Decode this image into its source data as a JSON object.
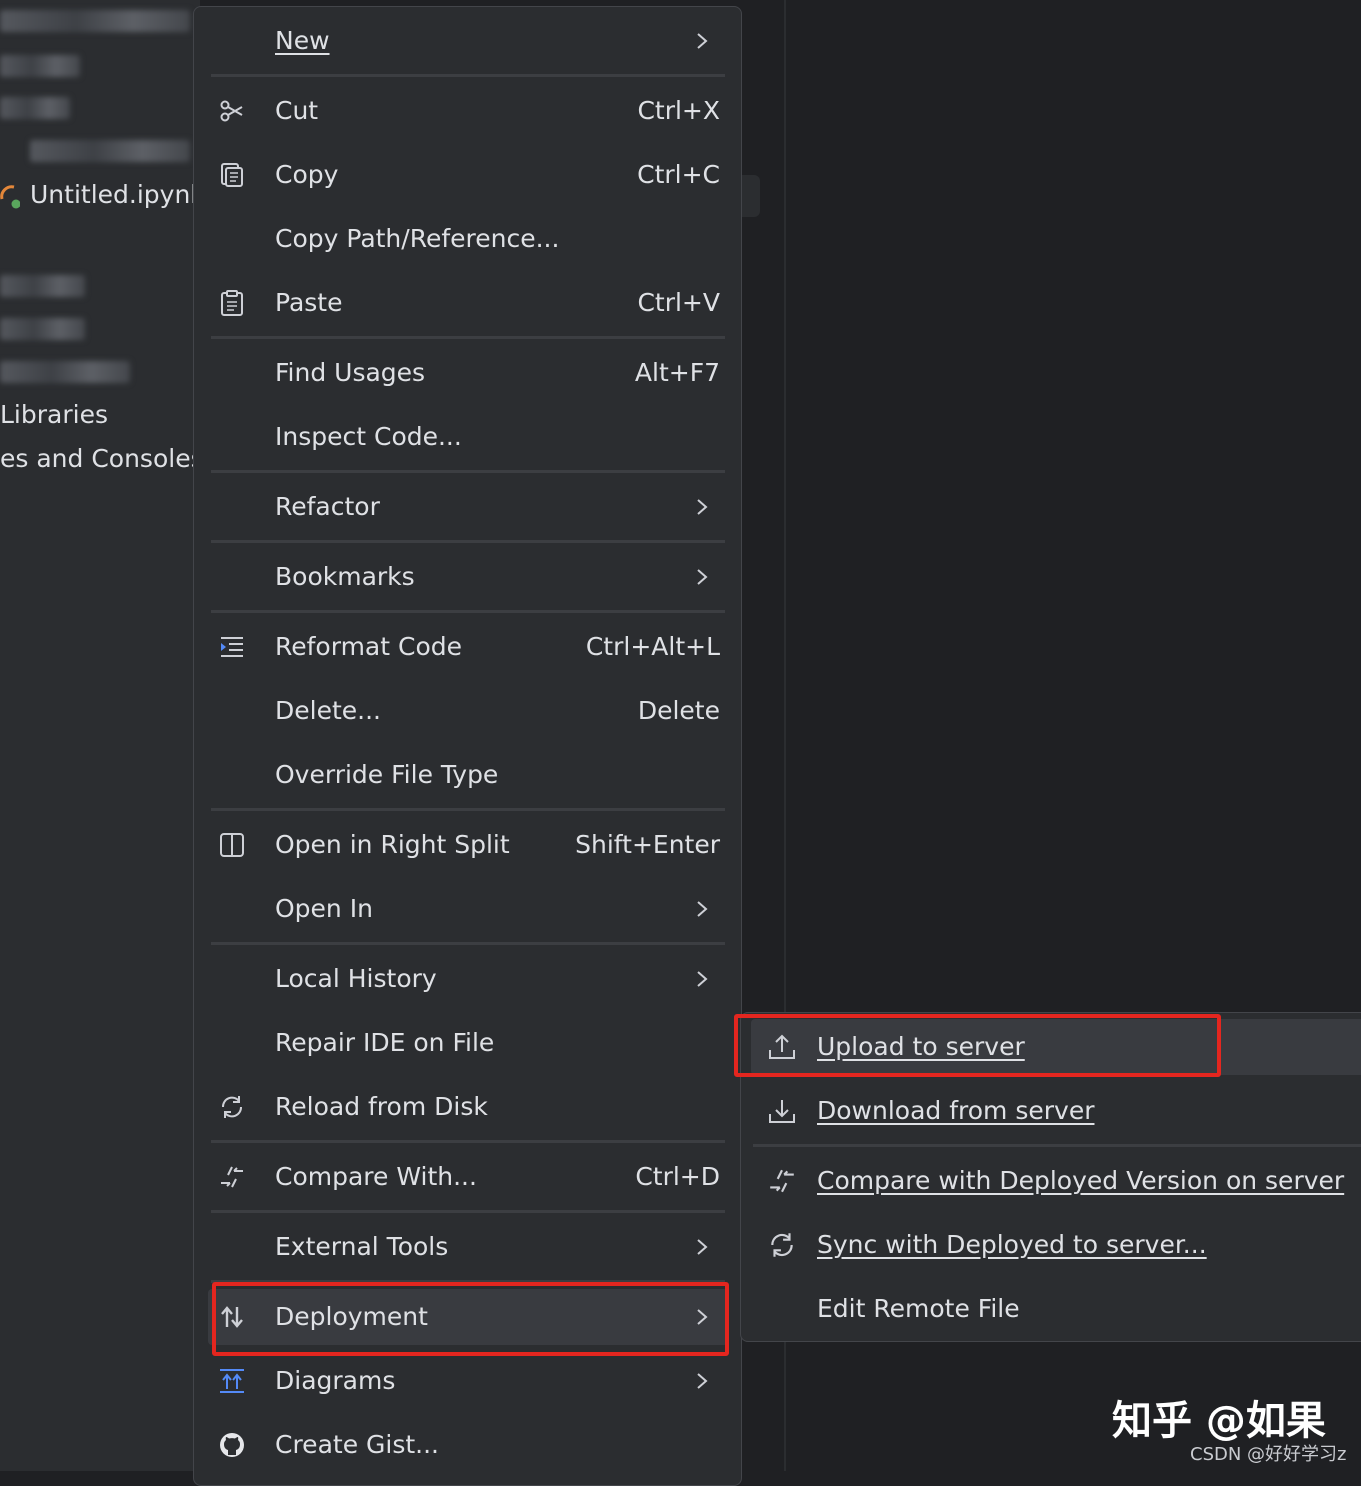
{
  "project_tree": {
    "file_name": "Untitled.ipynb",
    "items": [
      "Libraries",
      "es and Consoles"
    ]
  },
  "context_menu": {
    "items": [
      {
        "label": "New",
        "submenu": true
      },
      {
        "label": "Cut",
        "shortcut": "Ctrl+X",
        "icon": "scissors-icon"
      },
      {
        "label": "Copy",
        "shortcut": "Ctrl+C",
        "icon": "copy-icon"
      },
      {
        "label": "Copy Path/Reference..."
      },
      {
        "label": "Paste",
        "shortcut": "Ctrl+V",
        "icon": "clipboard-icon"
      },
      {
        "label": "Find Usages",
        "shortcut": "Alt+F7"
      },
      {
        "label": "Inspect Code..."
      },
      {
        "label": "Refactor",
        "submenu": true
      },
      {
        "label": "Bookmarks",
        "submenu": true
      },
      {
        "label": "Reformat Code",
        "shortcut": "Ctrl+Alt+L",
        "icon": "reformat-icon"
      },
      {
        "label": "Delete...",
        "shortcut": "Delete"
      },
      {
        "label": "Override File Type"
      },
      {
        "label": "Open in Right Split",
        "shortcut": "Shift+Enter",
        "icon": "split-icon"
      },
      {
        "label": "Open In",
        "submenu": true
      },
      {
        "label": "Local History",
        "submenu": true
      },
      {
        "label": "Repair IDE on File"
      },
      {
        "label": "Reload from Disk",
        "icon": "reload-icon"
      },
      {
        "label": "Compare With...",
        "shortcut": "Ctrl+D",
        "icon": "compare-icon"
      },
      {
        "label": "External Tools",
        "submenu": true
      },
      {
        "label": "Deployment",
        "submenu": true,
        "icon": "deployment-icon",
        "highlighted": true
      },
      {
        "label": "Diagrams",
        "submenu": true,
        "icon": "diagrams-icon"
      },
      {
        "label": "Create Gist...",
        "icon": "github-icon"
      }
    ]
  },
  "deployment_submenu": {
    "items": [
      {
        "label": "Upload to server",
        "icon": "upload-icon",
        "highlighted": true
      },
      {
        "label": "Download from server",
        "icon": "download-icon"
      },
      {
        "label": "Compare with Deployed Version on server",
        "icon": "compare-icon"
      },
      {
        "label": "Sync with Deployed to server...",
        "icon": "sync-icon"
      },
      {
        "label": "Edit Remote File"
      }
    ]
  },
  "watermark": {
    "main": "知乎 @如果",
    "sub": "CSDN @好好学习z"
  },
  "colors": {
    "menu_bg": "#2b2d30",
    "hover_bg": "#393b40",
    "highlight_border": "#e4261f",
    "text": "#dfe1e5"
  }
}
